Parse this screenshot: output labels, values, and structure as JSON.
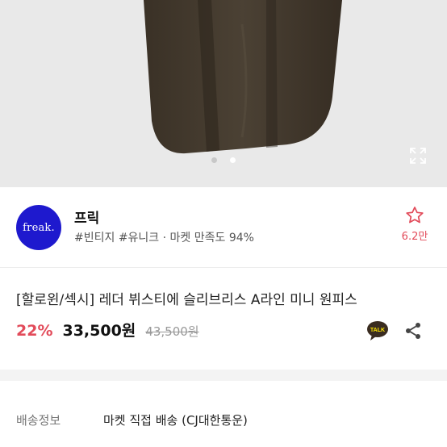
{
  "shop": {
    "logo_text": "freak.",
    "name": "프릭",
    "tags": "#빈티지 #유니크 · 마켓 만족도 94%",
    "favorite_count": "6.2만"
  },
  "product": {
    "title": "[할로윈/섹시] 레더 뷔스티에 슬리브리스 A라인 미니 원피스",
    "discount": "22%",
    "price": "33,500원",
    "original_price": "43,500원",
    "talk_label": "TALK"
  },
  "shipping": {
    "label": "배송정보",
    "value": "마켓 직접 배송 (CJ대한통운)"
  },
  "carousel": {
    "total": 2,
    "active": 2
  },
  "colors": {
    "accent": "#e24b5a",
    "logo_bg": "#1e19ce",
    "talk_bg": "#3a2c20"
  }
}
